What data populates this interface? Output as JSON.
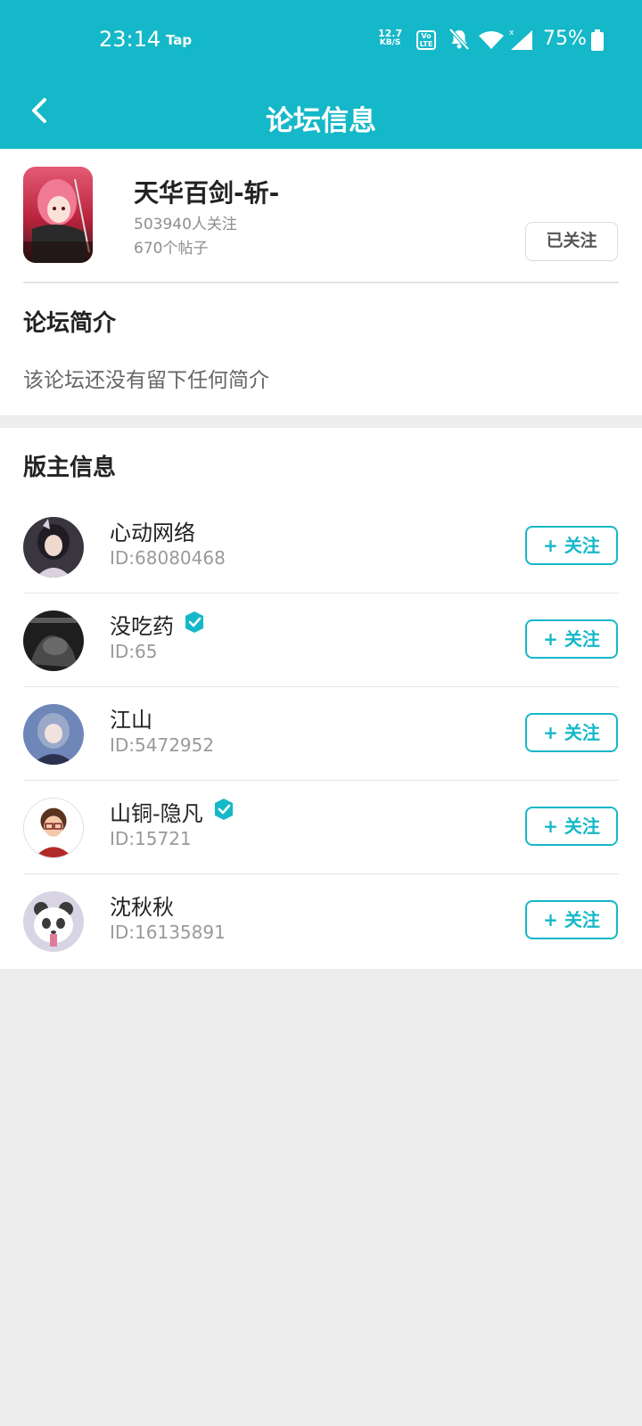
{
  "status": {
    "time": "23:14",
    "carrier": "Tap",
    "speed_value": "12.7",
    "speed_unit": "KB/S",
    "volte_top": "Vo",
    "volte_bottom": "LTE",
    "battery": "75%"
  },
  "navbar": {
    "title": "论坛信息"
  },
  "forum": {
    "name": "天华百剑-斩-",
    "followers": "503940人关注",
    "posts": "670个帖子",
    "followed_label": "已关注",
    "intro_heading": "论坛简介",
    "intro_text": "该论坛还没有留下任何简介"
  },
  "moderators": {
    "heading": "版主信息",
    "follow_label": "+ 关注",
    "items": [
      {
        "name": "心动网络",
        "id": "ID:68080468",
        "verified": false
      },
      {
        "name": "没吃药",
        "id": "ID:65",
        "verified": true
      },
      {
        "name": "江山",
        "id": "ID:5472952",
        "verified": false
      },
      {
        "name": "山铜-隐凡",
        "id": "ID:15721",
        "verified": true
      },
      {
        "name": "沈秋秋",
        "id": "ID:16135891",
        "verified": false
      }
    ]
  },
  "colors": {
    "accent": "#15b8c8",
    "background": "#ededed"
  }
}
